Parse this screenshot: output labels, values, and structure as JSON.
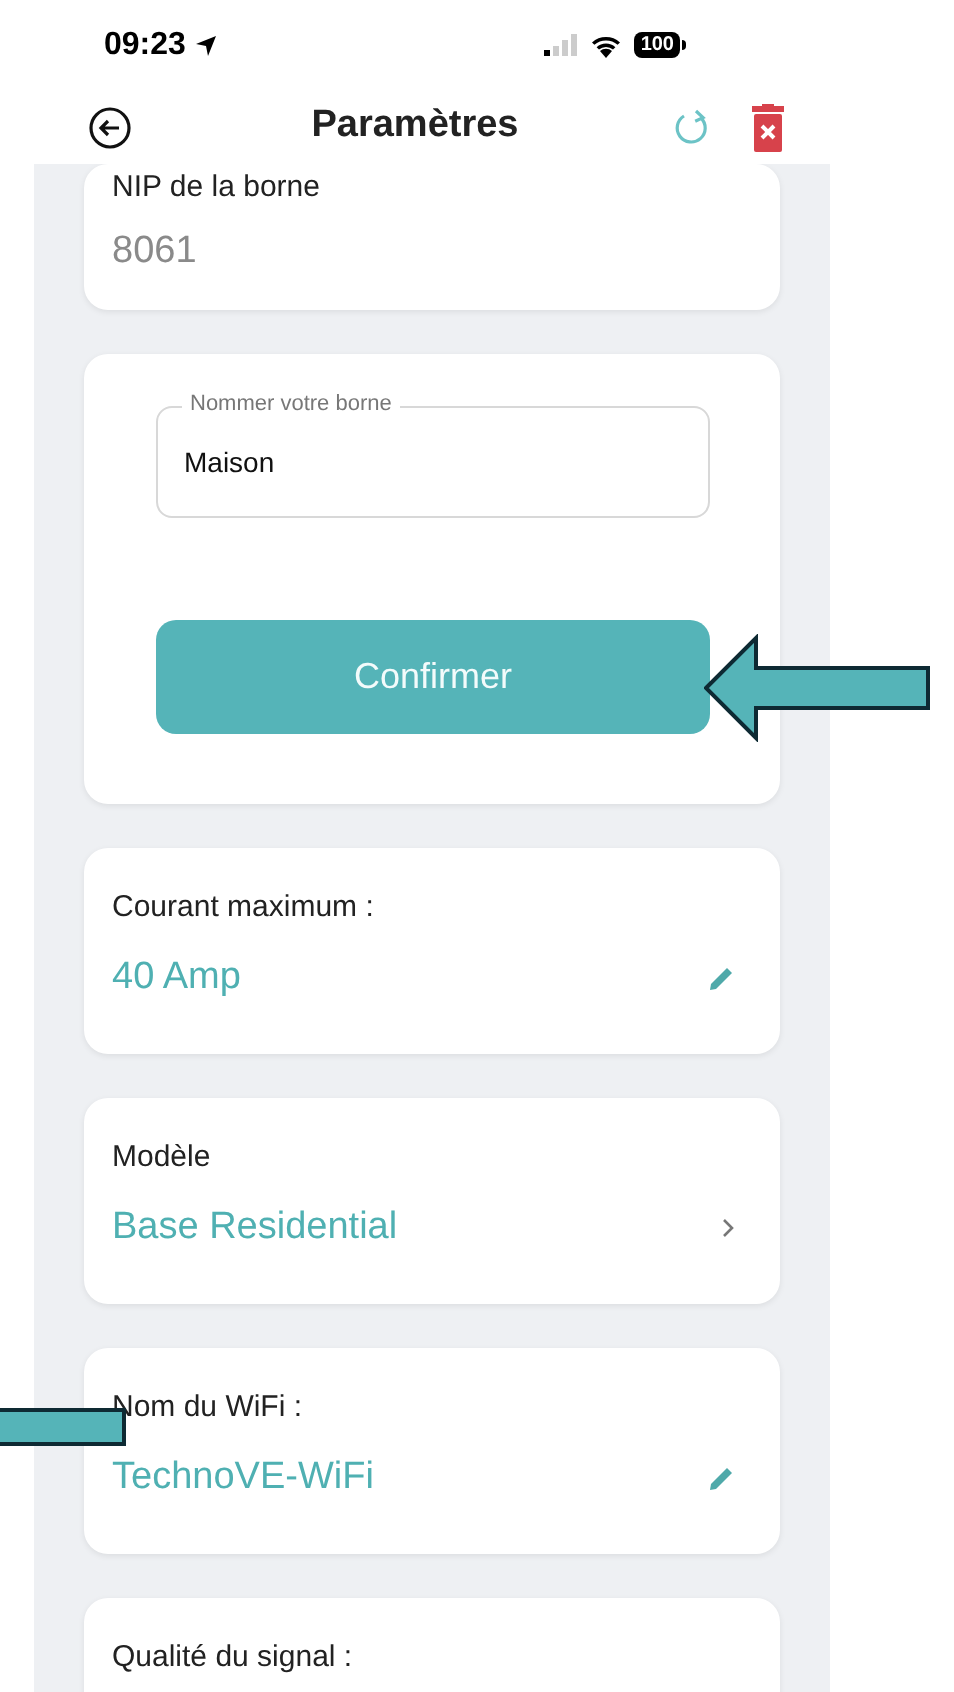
{
  "status_bar": {
    "time": "09:23",
    "battery": "100"
  },
  "header": {
    "title": "Paramètres"
  },
  "cards": [
    {
      "kind": "field",
      "label": "NIP de la borne",
      "value": "8061"
    },
    {
      "kind": "name_form",
      "input_label": "Nommer votre borne",
      "input_value": "Maison",
      "button": "Confirmer"
    },
    {
      "kind": "edit_setting",
      "label": "Courant maximum :",
      "value": "40 Amp"
    },
    {
      "kind": "link_setting",
      "label": "Modèle",
      "value": "Base Residential"
    },
    {
      "kind": "edit_setting",
      "label": "Nom du WiFi :",
      "value": "TechnoVE-WiFi"
    },
    {
      "kind": "label_only",
      "label": "Qualité du signal :"
    }
  ]
}
